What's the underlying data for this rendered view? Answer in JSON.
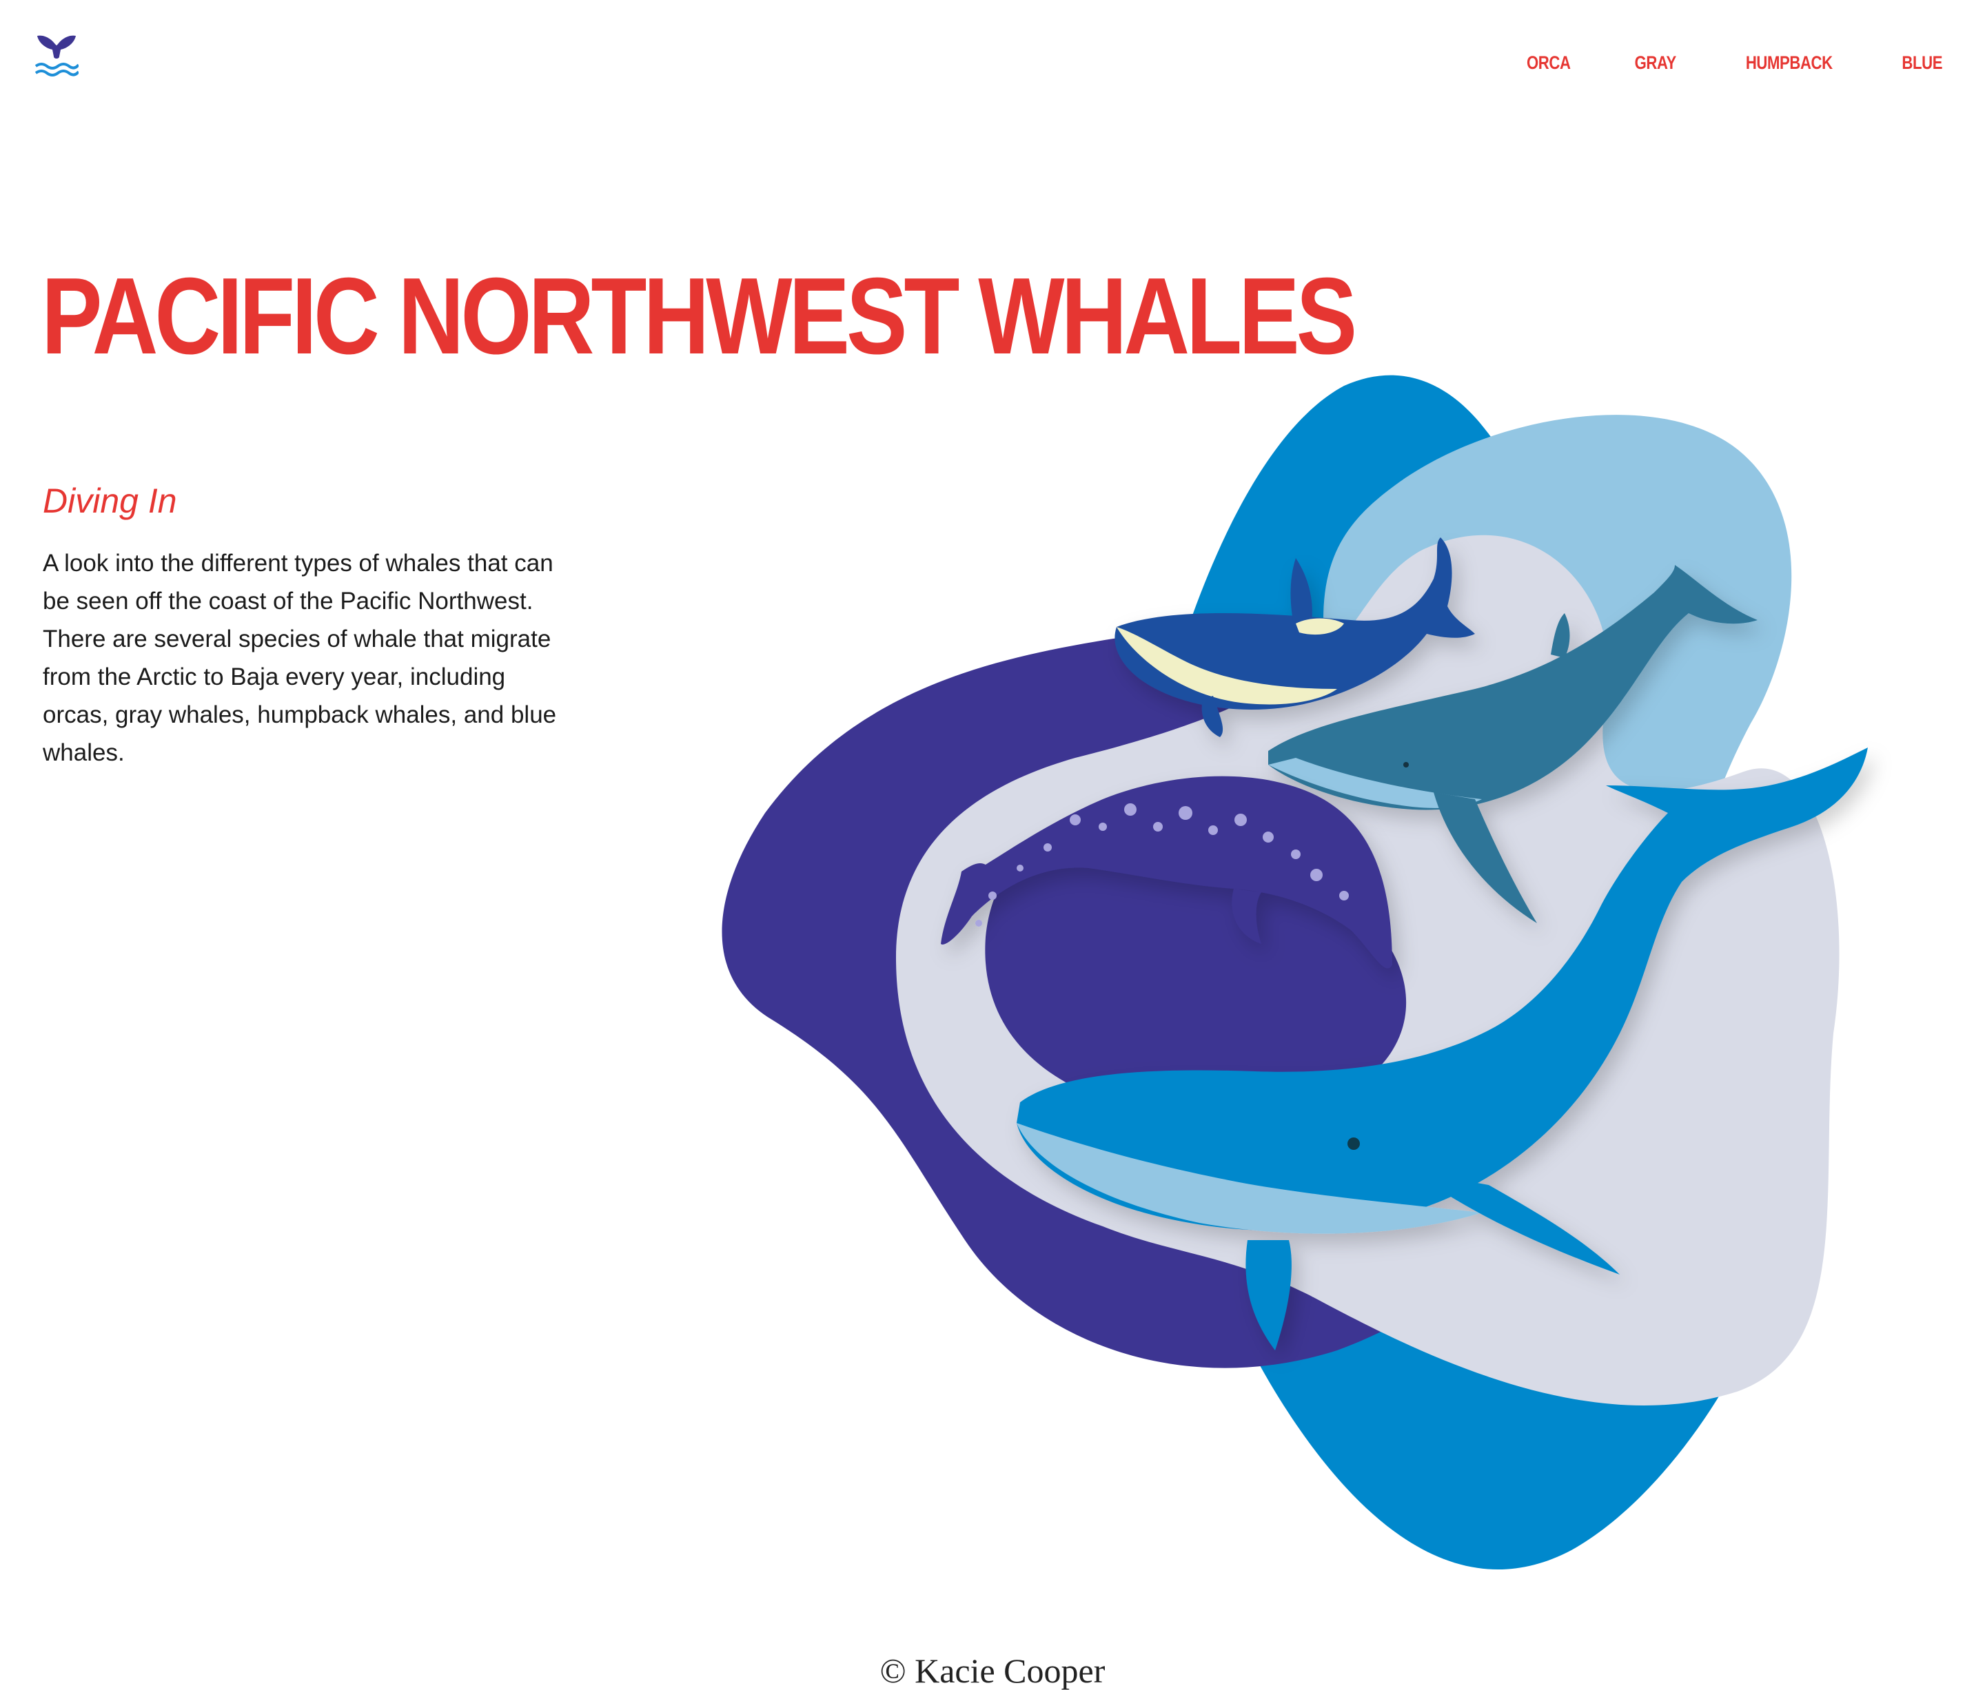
{
  "nav": {
    "logo_icon": "whale-tail-icon",
    "items": [
      {
        "label": "ORCA"
      },
      {
        "label": "GRAY"
      },
      {
        "label": "HUMPBACK"
      },
      {
        "label": "BLUE"
      }
    ]
  },
  "hero": {
    "title": "PACIFIC NORTHWEST WHALES",
    "subtitle": "Diving In",
    "intro": "A look into the different types of whales that can be seen off the coast of the Pacific Northwest. There are several species of whale that migrate from the Arctic to Baja every year, including orcas, gray whales, humpback whales, and blue whales."
  },
  "footer": {
    "copyright": "© Kacie Cooper"
  },
  "colors": {
    "accent": "#e63632",
    "navy": "#3d3592",
    "ocean_blue": "#0088cc",
    "light_blue": "#93c6e3",
    "pale": "#d8dbe7"
  }
}
